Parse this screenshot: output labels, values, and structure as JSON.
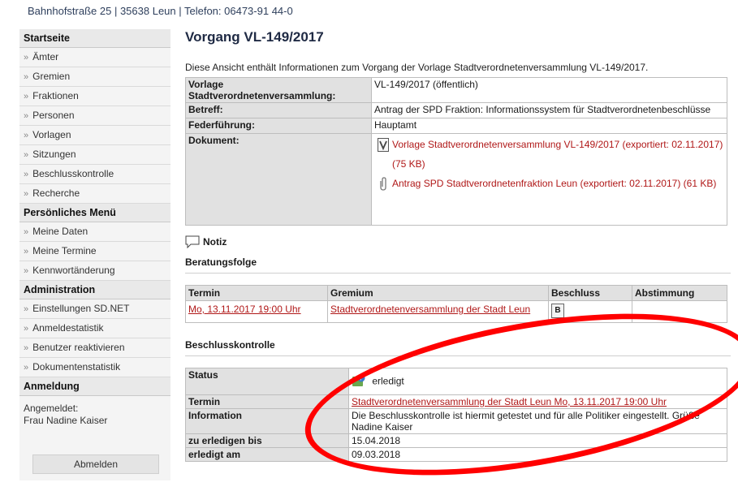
{
  "header": {
    "address": "Bahnhofstraße 25 | 35638 Leun | Telefon: 06473-91 44-0"
  },
  "sidebar": {
    "start": "Startseite",
    "main_items": [
      "Ämter",
      "Gremien",
      "Fraktionen",
      "Personen",
      "Vorlagen",
      "Sitzungen",
      "Beschlusskontrolle",
      "Recherche"
    ],
    "personal_head": "Persönliches Menü",
    "personal_items": [
      "Meine Daten",
      "Meine Termine",
      "Kennwortänderung"
    ],
    "admin_head": "Administration",
    "admin_items": [
      "Einstellungen SD.NET",
      "Anmeldestatistik",
      "Benutzer reaktivieren",
      "Dokumentenstatistik"
    ],
    "login_head": "Anmeldung",
    "logged_in_label": "Angemeldet:",
    "user": "Frau Nadine Kaiser",
    "logout": "Abmelden"
  },
  "main": {
    "title": "Vorgang VL-149/2017",
    "intro": "Diese Ansicht enthält Informationen zum Vorgang der Vorlage Stadtverordnetenversammlung VL-149/2017.",
    "info": {
      "vorlage_label": "Vorlage Stadtverordnetenversammlung:",
      "vorlage_value": "VL-149/2017 (öffentlich)",
      "betreff_label": "Betreff:",
      "betreff_value": "Antrag der SPD Fraktion: Informationssystem für Stadtverordnetenbeschlüsse",
      "federf_label": "Federführung:",
      "federf_value": "Hauptamt",
      "dok_label": "Dokument:",
      "dok1": "Vorlage Stadtverordnetenversammlung VL-149/2017 (exportiert: 02.11.2017) (75 KB)",
      "dok2": "Antrag SPD Stadtverordnetenfraktion Leun (exportiert: 02.11.2017) (61 KB)"
    },
    "notiz": "Notiz",
    "beratung": {
      "title": "Beratungsfolge",
      "headers": [
        "Termin",
        "Gremium",
        "Beschluss",
        "Abstimmung"
      ],
      "termin": "Mo, 13.11.2017 19:00 Uhr",
      "gremium": "Stadtverordnetenversammlung der Stadt Leun",
      "beschluss_icon": "B"
    },
    "kontrolle": {
      "title": "Beschlusskontrolle",
      "status_label": "Status",
      "status_value": "erledigt",
      "termin_label": "Termin",
      "termin_value": "Stadtverordnetenversammlung der Stadt Leun Mo, 13.11.2017 19:00 Uhr",
      "info_label": "Information",
      "info_value": "Die Beschlusskontrolle ist hiermit getestet und für alle Politiker eingestellt. Grüße Nadine Kaiser",
      "bis_label": "zu erledigen bis",
      "bis_value": "15.04.2018",
      "am_label": "erledigt am",
      "am_value": "09.03.2018"
    }
  },
  "annotation": {
    "color": "#ff0000"
  }
}
